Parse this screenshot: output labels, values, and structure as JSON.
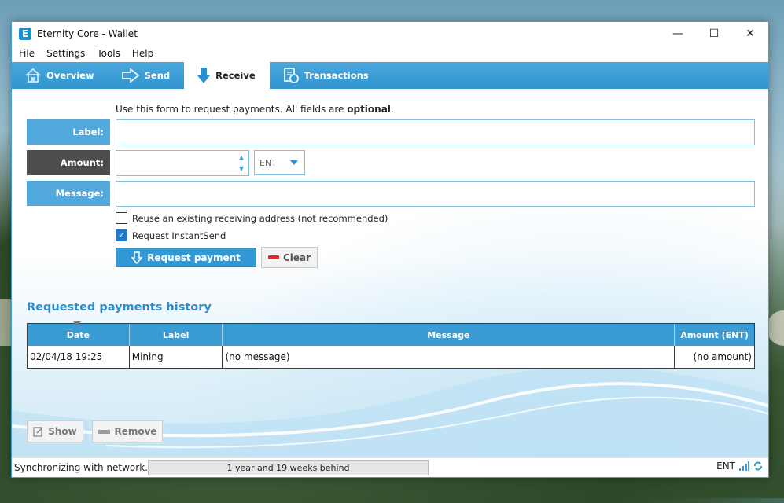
{
  "window": {
    "title": "Eternity Core - Wallet",
    "logo_letter": "E",
    "controls": {
      "minimize": "—",
      "maximize": "☐",
      "close": "✕"
    }
  },
  "menu": [
    "File",
    "Settings",
    "Tools",
    "Help"
  ],
  "tabs": [
    {
      "label": "Overview",
      "icon": "home-icon",
      "active": false
    },
    {
      "label": "Send",
      "icon": "arrow-right-icon",
      "active": false
    },
    {
      "label": "Receive",
      "icon": "arrow-down-icon",
      "active": true
    },
    {
      "label": "Transactions",
      "icon": "transactions-icon",
      "active": false
    }
  ],
  "receive_form": {
    "hint_prefix": "Use this form to request payments. All fields are ",
    "hint_bold": "optional",
    "hint_suffix": ".",
    "label_field": {
      "label": "Label:",
      "value": ""
    },
    "amount_field": {
      "label": "Amount:",
      "value": ""
    },
    "unit": "ENT",
    "message_field": {
      "label": "Message:",
      "value": ""
    },
    "reuse_address": {
      "label": "Reuse an existing receiving address (not recommended)",
      "checked": false
    },
    "instantsend": {
      "label": "Request InstantSend",
      "checked": true
    },
    "request_button": "Request payment",
    "clear_button": "Clear"
  },
  "history": {
    "title": "Requested payments history",
    "columns": [
      "Date",
      "Label",
      "Message",
      "Amount (ENT)"
    ],
    "rows": [
      {
        "date": "02/04/18 19:25",
        "label": "Mining",
        "message": "(no message)",
        "amount": "(no amount)"
      }
    ],
    "show_button": "Show",
    "remove_button": "Remove"
  },
  "status": {
    "text": "Synchronizing with network...",
    "progress_text": "1 year and 19 weeks behind",
    "unit": "ENT"
  },
  "colors": {
    "accent": "#3b9bd3",
    "label_bg": "#52a9dc",
    "label_dark_bg": "#4d4d4d",
    "title_blue": "#2d8ccb",
    "clear_red": "#e02a2a"
  }
}
